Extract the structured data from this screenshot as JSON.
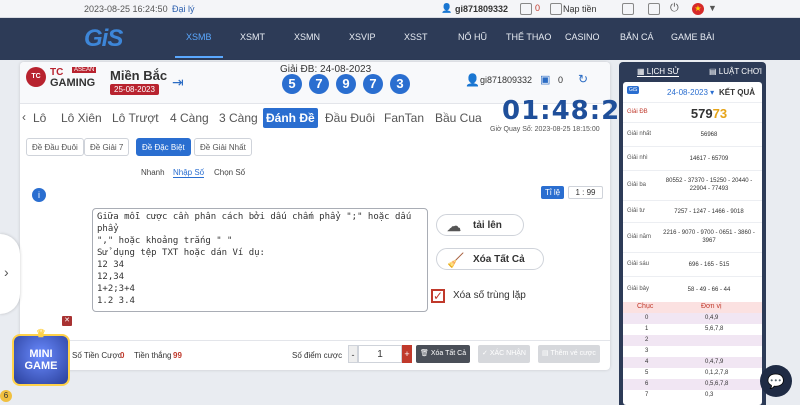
{
  "topbar": {
    "datetime": "2023-08-25 16:24:50",
    "agent": "Đại lý",
    "username": "gi871809332",
    "wallet_balance": "0",
    "deposit": "Nạp tiền"
  },
  "nav": {
    "logo": "GiS",
    "items": [
      "XSMB",
      "XSMT",
      "XSMN",
      "XSVIP",
      "XSST",
      "NỔ HŨ",
      "THỂ THAO",
      "CASINO",
      "BẮN CÁ",
      "GAME BÀI"
    ]
  },
  "panel": {
    "brand_tc": "TC",
    "brand_gaming": "GAMING",
    "brand_asean": "ASEAN",
    "region": "Miền Bắc",
    "region_date": "25-08-2023",
    "gdb_label": "Giải ĐB: 24-08-2023",
    "gdb_digits": [
      "5",
      "7",
      "9",
      "7",
      "3"
    ],
    "player": "gi871809332",
    "balance": "0"
  },
  "tabs": [
    "Lô",
    "Lô Xiên",
    "Lô Trượt",
    "4 Càng",
    "3 Càng",
    "Đánh Đề",
    "Đầu Đuôi",
    "FanTan",
    "Bầu Cua"
  ],
  "timer": {
    "countdown": "01:48:25",
    "close_time": "Giờ Quay Số: 2023-08-25 18:15:00"
  },
  "subtabs": [
    "Đề Đầu Đuôi",
    "Đề Giải 7",
    "Đề Đặc Biệt",
    "Đề Giải Nhất"
  ],
  "modes": [
    "Nhanh",
    "Nhập Số",
    "Chọn Số"
  ],
  "ratio": {
    "label": "Tỉ lệ",
    "value": "1 : 99"
  },
  "textarea": {
    "content": "Giữa mỗi cược cần phân cách bởi dấu chấm phẩy \";\" hoặc dấu phẩy\n\",\" hoặc khoảng trắng \" \"\nSử dụng tệp TXT hoặc dán Ví dụ:\n12 34\n12,34\n1+2;3+4\n1.2 3.4"
  },
  "actions": {
    "upload": "tải lên",
    "clear_all": "Xóa Tất Cả",
    "dedupe": "Xóa số trùng lặp"
  },
  "footer": {
    "bet_count_label": "Số Tiền Cược",
    "bet_count": "0",
    "win_label": "Tiền thắng",
    "win": "99",
    "points_label": "Số điểm cược",
    "points": "1",
    "clear_btn": "Xóa Tất Cả",
    "confirm_btn": "XÁC NHẬN",
    "add_btn": "Thêm vé cược"
  },
  "side": {
    "history_tab": "LỊCH SỬ",
    "rules_tab": "LUẬT CHƠI",
    "logo": "GiS",
    "date": "24-08-2023",
    "result_title": "KẾT QUẢ",
    "db_label": "Giải ĐB",
    "db_main": "579",
    "db_hl": "73",
    "rows": [
      {
        "label": "Giải nhất",
        "value": "56968"
      },
      {
        "label": "Giải nhì",
        "value": "14617 - 65709"
      },
      {
        "label": "Giải ba",
        "value": "80552 - 37370 - 15250 - 20440 - 22904 - 77493"
      },
      {
        "label": "Giải tư",
        "value": "7257 - 1247 - 1466 - 9018"
      },
      {
        "label": "Giải năm",
        "value": "2216 - 9070 - 9700 - 0651 - 3860 - 3967"
      },
      {
        "label": "Giải sáu",
        "value": "696 - 165 - 515"
      },
      {
        "label": "Giải bảy",
        "value": "58 - 49 - 66 - 44"
      }
    ],
    "chuc_head": "Chục",
    "donvi_head": "Đơn vị",
    "chuc_rows": [
      {
        "c": "0",
        "d": "0,4,9"
      },
      {
        "c": "1",
        "d": "5,6,7,8"
      },
      {
        "c": "2",
        "d": ""
      },
      {
        "c": "3",
        "d": ""
      },
      {
        "c": "4",
        "d": "0,4,7,9"
      },
      {
        "c": "5",
        "d": "0,1,2,7,8"
      },
      {
        "c": "6",
        "d": "0,5,6,7,8"
      },
      {
        "c": "7",
        "d": "0,3"
      },
      {
        "c": "8",
        "d": ""
      }
    ]
  },
  "floating": {
    "mini_line1": "MINI",
    "mini_line2": "GAME",
    "coin": "6"
  }
}
